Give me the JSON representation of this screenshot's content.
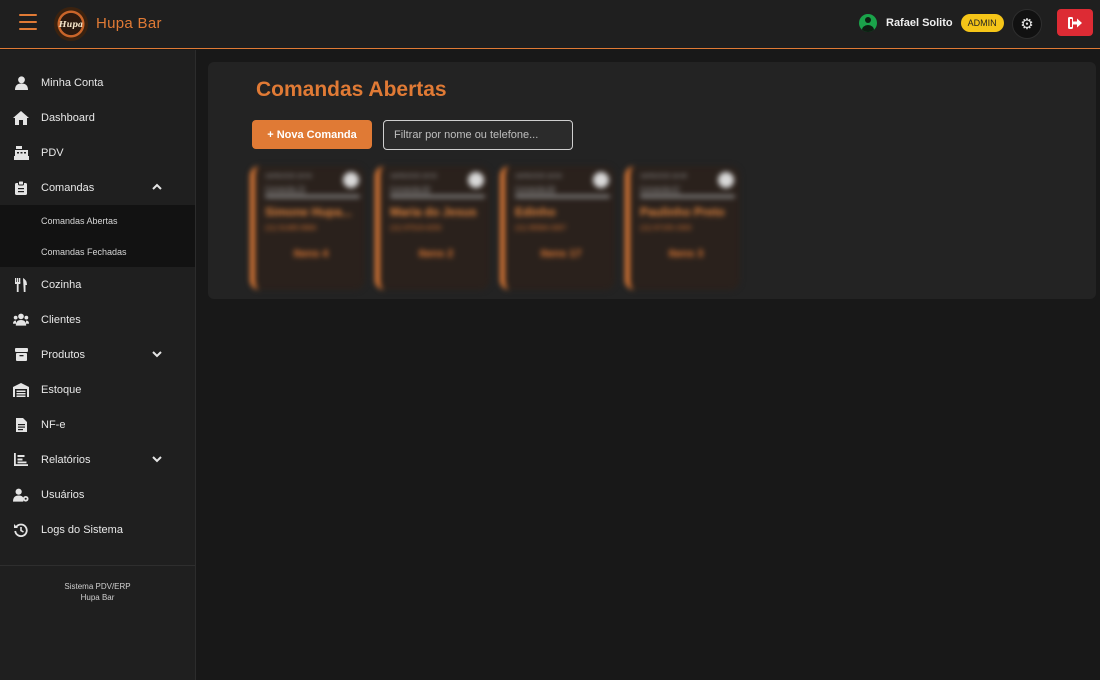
{
  "header": {
    "brand": "Hupa Bar",
    "logo_text": "Hupa",
    "user_name": "Rafael Solito",
    "role": "ADMIN"
  },
  "sidebar": {
    "items": [
      {
        "label": "Minha Conta",
        "icon": "user-icon"
      },
      {
        "label": "Dashboard",
        "icon": "home-icon"
      },
      {
        "label": "PDV",
        "icon": "cash-register-icon"
      },
      {
        "label": "Comandas",
        "icon": "clipboard-icon"
      },
      {
        "label": "Cozinha",
        "icon": "utensils-icon"
      },
      {
        "label": "Clientes",
        "icon": "users-icon"
      },
      {
        "label": "Produtos",
        "icon": "box-icon"
      },
      {
        "label": "Estoque",
        "icon": "warehouse-icon"
      },
      {
        "label": "NF-e",
        "icon": "document-icon"
      },
      {
        "label": "Relatórios",
        "icon": "chart-icon"
      },
      {
        "label": "Usuários",
        "icon": "user-gear-icon"
      },
      {
        "label": "Logs do Sistema",
        "icon": "history-icon"
      }
    ],
    "comandas_sub": [
      "Comandas Abertas",
      "Comandas Fechadas"
    ],
    "footer_line1": "Sistema PDV/ERP",
    "footer_line2": "Hupa Bar"
  },
  "main": {
    "title": "Comandas Abertas",
    "new_button": "+ Nova Comanda",
    "filter_placeholder": "Filtrar por nome ou telefone...",
    "cards": [
      {
        "date": "16/05/2025 19:04",
        "number": "Comanda 70",
        "name": "Simone Hupa...",
        "phone": "(11) 91485-9684",
        "items": "Itens 4"
      },
      {
        "date": "16/05/2025 19:03",
        "number": "Comanda 69",
        "name": "Maria do Jesus",
        "phone": "(11) 97519-4253",
        "items": "Itens 2"
      },
      {
        "date": "16/05/2025 18:54",
        "number": "Comanda 68",
        "name": "Edinho",
        "phone": "(11) 95584-3307",
        "items": "Itens 17"
      },
      {
        "date": "16/05/2025 18:49",
        "number": "Comanda 67",
        "name": "Paulinho Preto",
        "phone": "(11) 97155-1503",
        "items": "Itens 3"
      }
    ]
  },
  "colors": {
    "accent": "#e07a35",
    "badge": "#f5c518",
    "logout": "#dd2b34",
    "online": "#1aa34a"
  }
}
